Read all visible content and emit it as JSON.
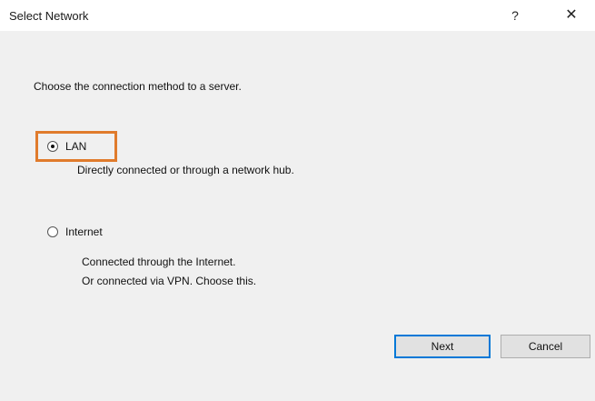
{
  "window": {
    "title": "Select Network",
    "help_glyph": "?",
    "close_glyph": "✕"
  },
  "content": {
    "instruction": "Choose the connection method to a server.",
    "options": [
      {
        "label": "LAN",
        "selected": true,
        "description_lines": [
          "Directly connected or through a network hub."
        ]
      },
      {
        "label": "Internet",
        "selected": false,
        "description_lines": [
          "Connected through the Internet.",
          "Or connected via VPN. Choose this."
        ]
      }
    ]
  },
  "buttons": {
    "next": "Next",
    "cancel": "Cancel"
  },
  "colors": {
    "highlight": "#e07b2c",
    "client_background": "#f0f0f0"
  }
}
